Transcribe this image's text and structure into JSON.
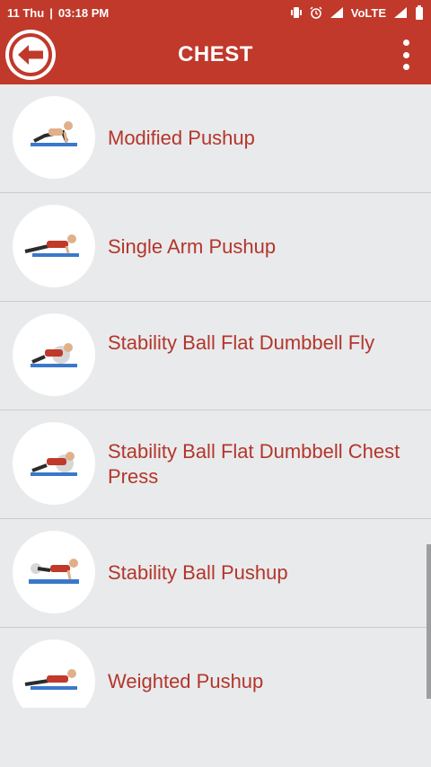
{
  "status_bar": {
    "date": "11 Thu",
    "separator": "|",
    "time": "03:18 PM",
    "network": "VoLTE"
  },
  "header": {
    "title": "CHEST",
    "background": "#c0392b"
  },
  "exercises": [
    {
      "label": "Modified Pushup",
      "icon": "modified-pushup-icon"
    },
    {
      "label": "Single Arm Pushup",
      "icon": "single-arm-pushup-icon"
    },
    {
      "label": "Stability Ball Flat Dumbbell Fly",
      "icon": "stability-ball-fly-icon"
    },
    {
      "label": "Stability Ball Flat Dumbbell Chest Press",
      "icon": "stability-ball-press-icon"
    },
    {
      "label": "Stability Ball Pushup",
      "icon": "stability-ball-pushup-icon"
    },
    {
      "label": "Weighted Pushup",
      "icon": "weighted-pushup-icon"
    }
  ],
  "colors": {
    "accent": "#c0392b",
    "label": "#b3362b",
    "background": "#e9eaec"
  }
}
